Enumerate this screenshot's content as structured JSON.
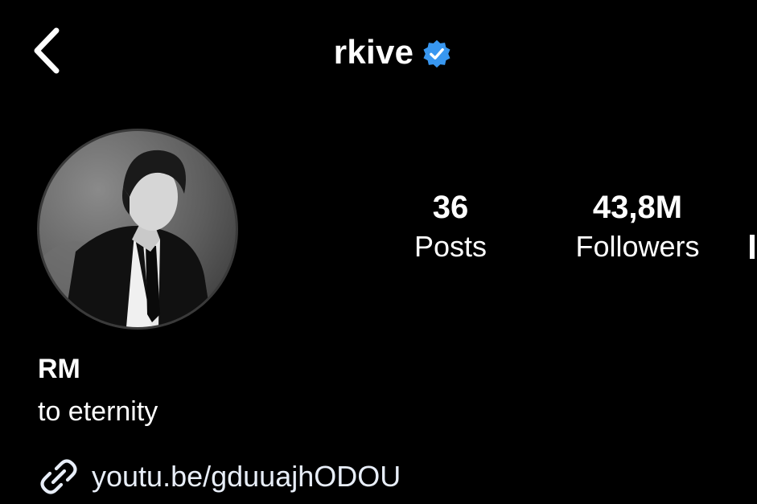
{
  "header": {
    "back_icon": "chevron-left-icon",
    "username": "rkive",
    "verified_icon": "verified-badge-icon",
    "verified_color": "#3897f0"
  },
  "profile": {
    "avatar": "profile-photo",
    "name": "RM",
    "bio": "to eternity",
    "link_icon": "link-icon",
    "link": "youtu.be/gduuajhODOU"
  },
  "stats": [
    {
      "value": "36",
      "label": "Posts"
    },
    {
      "value": "43,8M",
      "label": "Followers"
    }
  ],
  "colors": {
    "background": "#000000",
    "text": "#ffffff"
  }
}
